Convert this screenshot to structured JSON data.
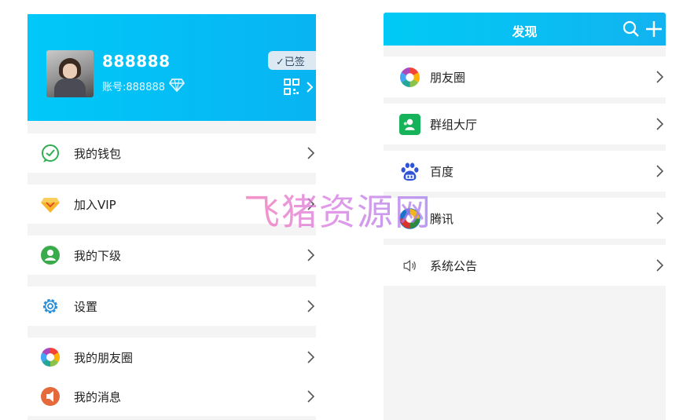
{
  "profile": {
    "username": "888888",
    "account": "账号:888888",
    "signed_label": "✓已签"
  },
  "menu": [
    {
      "label": "我的钱包",
      "icon": "wallet-icon"
    },
    {
      "label": "加入VIP",
      "icon": "vip-diamond-icon"
    },
    {
      "label": "我的下级",
      "icon": "subordinate-user-icon"
    },
    {
      "label": "设置",
      "icon": "gear-icon"
    },
    {
      "label": "我的朋友圈",
      "icon": "moments-icon"
    },
    {
      "label": "我的消息",
      "icon": "message-icon"
    }
  ],
  "discover": {
    "title": "发现",
    "items": [
      {
        "label": "朋友圈",
        "icon": "moments-icon"
      },
      {
        "label": "群组大厅",
        "icon": "group-hall-icon"
      },
      {
        "label": "百度",
        "icon": "baidu-icon"
      },
      {
        "label": "腾讯",
        "icon": "tencent-icon"
      },
      {
        "label": "系统公告",
        "icon": "speaker-icon"
      }
    ]
  },
  "watermark": "飞猪资源网",
  "colors": {
    "header_start": "#00c8f8",
    "header_end": "#08b4f2",
    "background": "#f4f4f4"
  }
}
